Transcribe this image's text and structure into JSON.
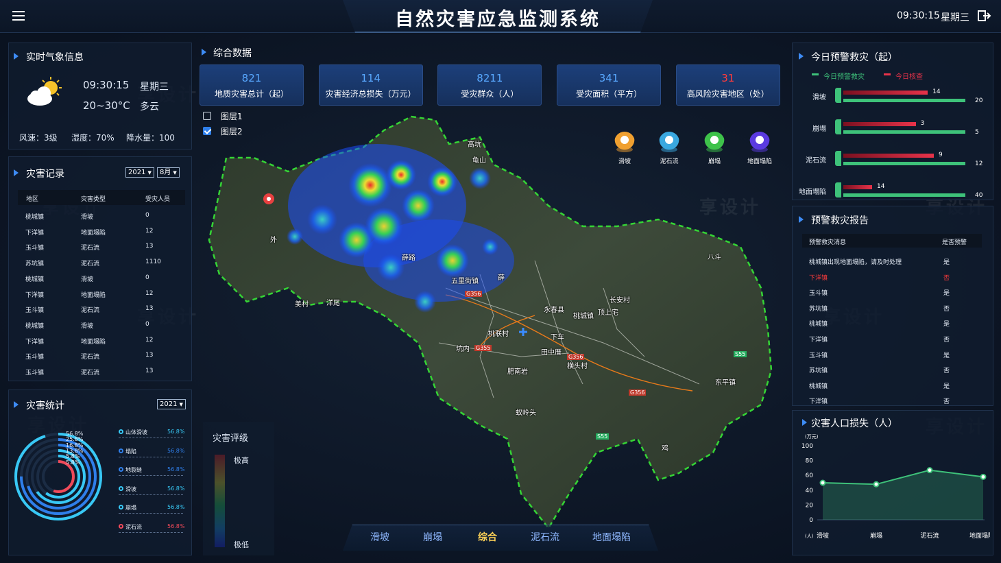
{
  "header": {
    "title": "自然灾害应急监测系统",
    "time": "09:30:15",
    "weekday": "星期三"
  },
  "weather": {
    "title": "实时气象信息",
    "time": "09:30:15",
    "weekday": "星期三",
    "temp": "20~30°C",
    "condition": "多云",
    "wind": "风速：3级",
    "humidity": "湿度：70%",
    "rain": "降水量：100"
  },
  "records": {
    "title": "灾害记录",
    "year": "2021",
    "month": "8月",
    "headers": [
      "地区",
      "灾害类型",
      "受灾人员"
    ],
    "rows": [
      [
        "桃城镇",
        "滑坡",
        "0"
      ],
      [
        "下洋镇",
        "地面塌陷",
        "12"
      ],
      [
        "玉斗镇",
        "泥石流",
        "13"
      ],
      [
        "苏坑镇",
        "泥石流",
        "1110"
      ],
      [
        "桃城镇",
        "滑坡",
        "0"
      ],
      [
        "下洋镇",
        "地面塌陷",
        "12"
      ],
      [
        "玉斗镇",
        "泥石流",
        "13"
      ],
      [
        "桃城镇",
        "滑坡",
        "0"
      ],
      [
        "下洋镇",
        "地面塌陷",
        "12"
      ],
      [
        "玉斗镇",
        "泥石流",
        "13"
      ],
      [
        "玉斗镇",
        "泥石流",
        "13"
      ]
    ]
  },
  "stats": {
    "title": "灾害统计",
    "year": "2021",
    "ring_labels": [
      "56.8%",
      "25.8%",
      "16.8%",
      "13.8%",
      "5.8%",
      "5.8%"
    ],
    "legend": [
      {
        "name": "山体滑坡",
        "value": "56.8%",
        "color": "#38c8f5"
      },
      {
        "name": "塌陷",
        "value": "56.8%",
        "color": "#2f7fea"
      },
      {
        "name": "地裂缝",
        "value": "56.8%",
        "color": "#2f7fea"
      },
      {
        "name": "滑坡",
        "value": "56.8%",
        "color": "#38c8f5"
      },
      {
        "name": "崩塌",
        "value": "56.8%",
        "color": "#38c8f5"
      },
      {
        "name": "泥石流",
        "value": "56.8%",
        "color": "#f04a5a"
      }
    ]
  },
  "summary": {
    "title": "综合数据",
    "cards": [
      {
        "value": "821",
        "label": "地质灾害总计（起）",
        "color": "#58a8ff"
      },
      {
        "value": "114",
        "label": "灾害经济总损失（万元）",
        "color": "#58a8ff"
      },
      {
        "value": "8211",
        "label": "受灾群众（人）",
        "color": "#58a8ff"
      },
      {
        "value": "341",
        "label": "受灾面积（平方）",
        "color": "#58a8ff"
      },
      {
        "value": "31",
        "label": "高风险灾害地区（处）",
        "color": "#ff3b3b"
      }
    ],
    "layers": [
      {
        "label": "图层1",
        "checked": false
      },
      {
        "label": "图层2",
        "checked": true
      }
    ]
  },
  "map": {
    "pins": [
      {
        "label": "滑坡",
        "color": "#f0a030"
      },
      {
        "label": "泥石流",
        "color": "#3aa8e0"
      },
      {
        "label": "崩塌",
        "color": "#3ec24a"
      },
      {
        "label": "地面塌陷",
        "color": "#5a3ae0"
      }
    ],
    "places": [
      "高坑",
      "龟山",
      "外",
      "薛",
      "美村",
      "洋尾",
      "五里街镇",
      "薛路",
      "永春县",
      "桃城镇",
      "长安村",
      "顶上宅",
      "下车",
      "桃联村",
      "坑内",
      "田中厝",
      "横头村",
      "肥南岩",
      "八斗",
      "东平镇",
      "蚁岭头",
      "鸡",
      "G356",
      "G355",
      "S55",
      "G356",
      "S55",
      "G356"
    ]
  },
  "rating": {
    "title": "灾害评级",
    "high": "极高",
    "low": "极低"
  },
  "tabs": {
    "items": [
      "滑坡",
      "崩塌",
      "综合",
      "泥石流",
      "地面塌陷"
    ],
    "active": 2
  },
  "warning": {
    "title": "今日预警救灾（起）",
    "legend_warn": "今日预警救灾",
    "legend_check": "今日核查",
    "colors": {
      "warn": "#3ec27a",
      "check": "#e8334a"
    },
    "items": [
      {
        "name": "滑坡",
        "check": 14,
        "warn": 20
      },
      {
        "name": "崩塌",
        "check": 3,
        "warn": 5
      },
      {
        "name": "泥石流",
        "check": 9,
        "warn": 12
      },
      {
        "name": "地面塌陷",
        "check": 14,
        "warn": 40
      }
    ]
  },
  "report": {
    "title": "预警救灾报告",
    "headers": [
      "预警救灾消息",
      "是否预警"
    ],
    "rows": [
      {
        "msg": "桃城镇出现地面塌陷，请及时处理",
        "flag": "是",
        "alert": false
      },
      {
        "msg": "下洋镇",
        "flag": "否",
        "alert": true
      },
      {
        "msg": "玉斗镇",
        "flag": "是",
        "alert": false
      },
      {
        "msg": "苏坑镇",
        "flag": "否",
        "alert": false
      },
      {
        "msg": "桃城镇",
        "flag": "是",
        "alert": false
      },
      {
        "msg": "下洋镇",
        "flag": "否",
        "alert": false
      },
      {
        "msg": "玉斗镇",
        "flag": "是",
        "alert": false
      },
      {
        "msg": "苏坑镇",
        "flag": "否",
        "alert": false
      },
      {
        "msg": "桃城镇",
        "flag": "是",
        "alert": false
      },
      {
        "msg": "下洋镇",
        "flag": "否",
        "alert": false
      }
    ]
  },
  "chart_data": {
    "type": "area",
    "title": "灾害人口损失（人）",
    "ylabel": "(万元)",
    "xlabel": "(人)",
    "categories": [
      "滑坡",
      "崩塌",
      "泥石流",
      "地面塌陷"
    ],
    "values": [
      50,
      48,
      67,
      58
    ],
    "ylim": [
      0,
      100
    ],
    "yticks": [
      0,
      20,
      40,
      60,
      80,
      100
    ],
    "color": "#3ec27a"
  },
  "watermark": "享设计"
}
